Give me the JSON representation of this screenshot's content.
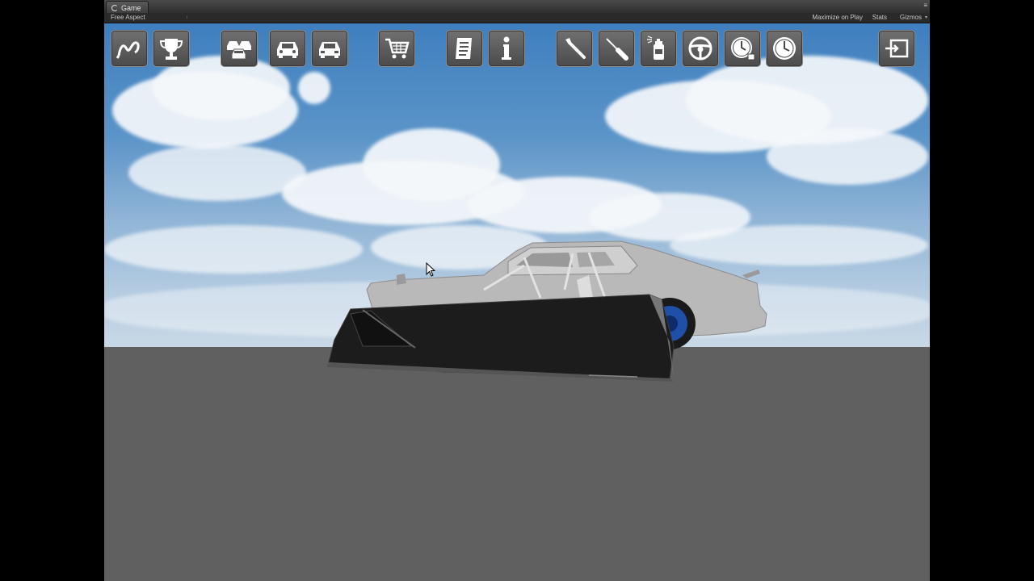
{
  "window": {
    "tab_title": "Game",
    "menu_glyph": "≡"
  },
  "toolbar": {
    "aspect": "Free Aspect",
    "aspect_arrow": "↕",
    "maximize_on_play": "Maximize on Play",
    "stats": "Stats",
    "gizmos": "Gizmos",
    "gizmos_arrow": "▾"
  },
  "hud_buttons": [
    {
      "name": "track-icon"
    },
    {
      "name": "trophy-icon"
    },
    {
      "name": "car-lot-icon"
    },
    {
      "name": "car-front-icon"
    },
    {
      "name": "car-rear-icon"
    },
    {
      "name": "shopping-cart-icon"
    },
    {
      "name": "checklist-icon"
    },
    {
      "name": "info-icon"
    },
    {
      "name": "wrench-icon"
    },
    {
      "name": "screwdriver-icon"
    },
    {
      "name": "spray-can-icon"
    },
    {
      "name": "steering-wheel-icon"
    },
    {
      "name": "gauge-clock-icon"
    },
    {
      "name": "clock-icon"
    },
    {
      "name": "exit-icon"
    }
  ],
  "colors": {
    "ground": "#606060",
    "button_bg": "#5c5c5c",
    "car_body": "#b8b8b8",
    "wheel_accent": "#1f4fa8"
  }
}
